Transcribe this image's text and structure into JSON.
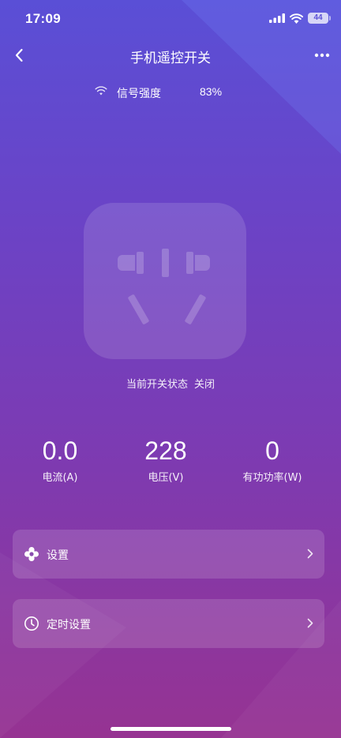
{
  "status_bar": {
    "time": "17:09",
    "battery": "44"
  },
  "nav": {
    "title": "手机遥控开关",
    "back_icon": "chevron-left-icon",
    "more_icon": "more-dots-icon"
  },
  "signal": {
    "icon": "wifi-icon",
    "label": "信号强度",
    "value": "83%"
  },
  "switch": {
    "status_label": "当前开关状态",
    "status_value": "关闭",
    "icon": "power-socket-icon"
  },
  "metrics": [
    {
      "value": "0.0",
      "label": "电流(A)"
    },
    {
      "value": "228",
      "label": "电压(V)"
    },
    {
      "value": "0",
      "label": "有功功率(W)"
    }
  ],
  "menu": [
    {
      "label": "设置",
      "icon": "gear-icon"
    },
    {
      "label": "定时设置",
      "icon": "clock-icon"
    }
  ],
  "colors": {
    "background_top": "#5a4fd6",
    "background_bottom": "#963392",
    "text": "#ffffff"
  }
}
